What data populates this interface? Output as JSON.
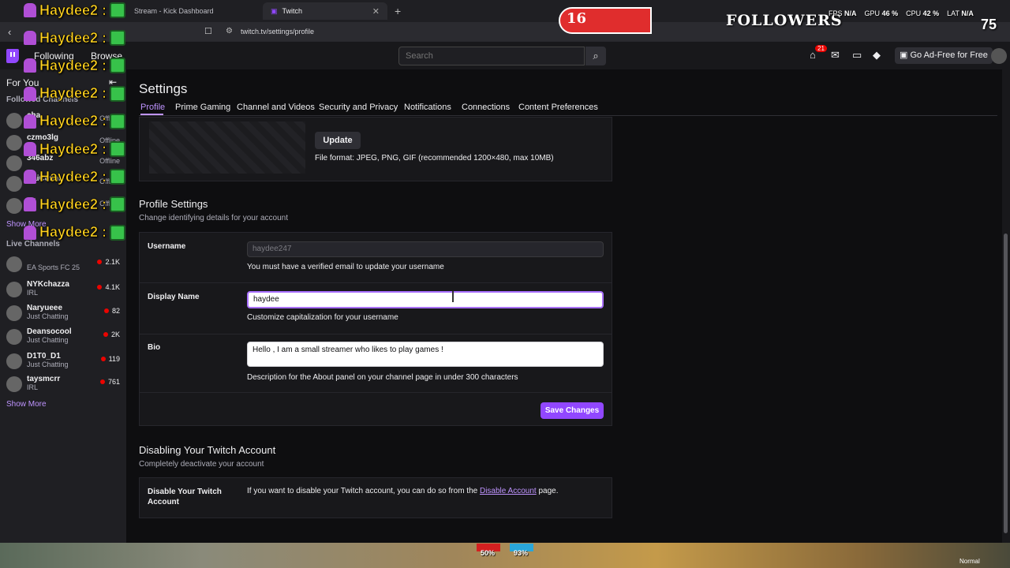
{
  "browser": {
    "tabs": [
      {
        "label": "Stream - Kick Dashboard"
      },
      {
        "label": "Twitch"
      }
    ],
    "url": "twitch.tv/settings/profile"
  },
  "topnav": {
    "following": "Following",
    "browse": "Browse",
    "search_placeholder": "Search",
    "notif_count": "21",
    "adfree": "Go Ad-Free for Free"
  },
  "sidebar": {
    "for_you": "For You",
    "followed_header": "Followed Channels",
    "followed": [
      {
        "name": "cha",
        "status": "Offline"
      },
      {
        "name": "czmo3lg",
        "status": "Offline"
      },
      {
        "name": "346abz",
        "status": "Offline"
      },
      {
        "name": "KaiCenat",
        "status": "Offline"
      },
      {
        "name": "cy",
        "status": "Offline"
      }
    ],
    "show_more": "Show More",
    "live_header": "Live Channels",
    "live": [
      {
        "name": "",
        "game": "EA Sports FC 25",
        "viewers": "2.1K"
      },
      {
        "name": "NYKchazza",
        "game": "IRL",
        "viewers": "4.1K"
      },
      {
        "name": "Naryueee",
        "game": "Just Chatting",
        "viewers": "82"
      },
      {
        "name": "Deansocool",
        "game": "Just Chatting",
        "viewers": "2K"
      },
      {
        "name": "D1T0_D1",
        "game": "Just Chatting",
        "viewers": "119"
      },
      {
        "name": "taysmcrr",
        "game": "IRL",
        "viewers": "761"
      }
    ],
    "show_more_2": "Show More"
  },
  "overlay": {
    "chat_name": "Haydee2 :",
    "chat_count": 9,
    "followers_count": "16",
    "followers_label": "FOLLOWERS",
    "followers_goal": "75",
    "hud": {
      "fps_label": "FPS",
      "fps": "N/A",
      "gpu_label": "GPU",
      "gpu": "46 %",
      "cpu_label": "CPU",
      "cpu": "42 %",
      "lat_label": "LAT",
      "lat": "N/A"
    },
    "game_health": "50%",
    "game_armor": "93%",
    "game_mode": "Normal"
  },
  "settings": {
    "title": "Settings",
    "tabs": [
      "Profile",
      "Prime Gaming",
      "Channel and Videos",
      "Security and Privacy",
      "Notifications",
      "Connections",
      "Content Preferences"
    ],
    "banner": {
      "update_label": "Update",
      "hint": "File format: JPEG, PNG, GIF (recommended 1200×480, max 10MB)"
    },
    "profile": {
      "title": "Profile Settings",
      "subtitle": "Change identifying details for your account",
      "username_label": "Username",
      "username_value": "haydee247",
      "username_help": "You must have a verified email to update your username",
      "display_label": "Display Name",
      "display_value": "haydee",
      "display_help": "Customize capitalization for your username",
      "bio_label": "Bio",
      "bio_value": "Hello , I am a small streamer who likes to play games !",
      "bio_help": "Description for the About panel on your channel page in under 300 characters",
      "save_label": "Save Changes"
    },
    "disable": {
      "title": "Disabling Your Twitch Account",
      "subtitle": "Completely deactivate your account",
      "label": "Disable Your Twitch Account",
      "text_pre": "If you want to disable your Twitch account, you can do so from the ",
      "link": "Disable Account",
      "text_post": " page."
    }
  },
  "colors": {
    "accent": "#9147ff",
    "link": "#bf94ff",
    "live": "#eb0400"
  }
}
